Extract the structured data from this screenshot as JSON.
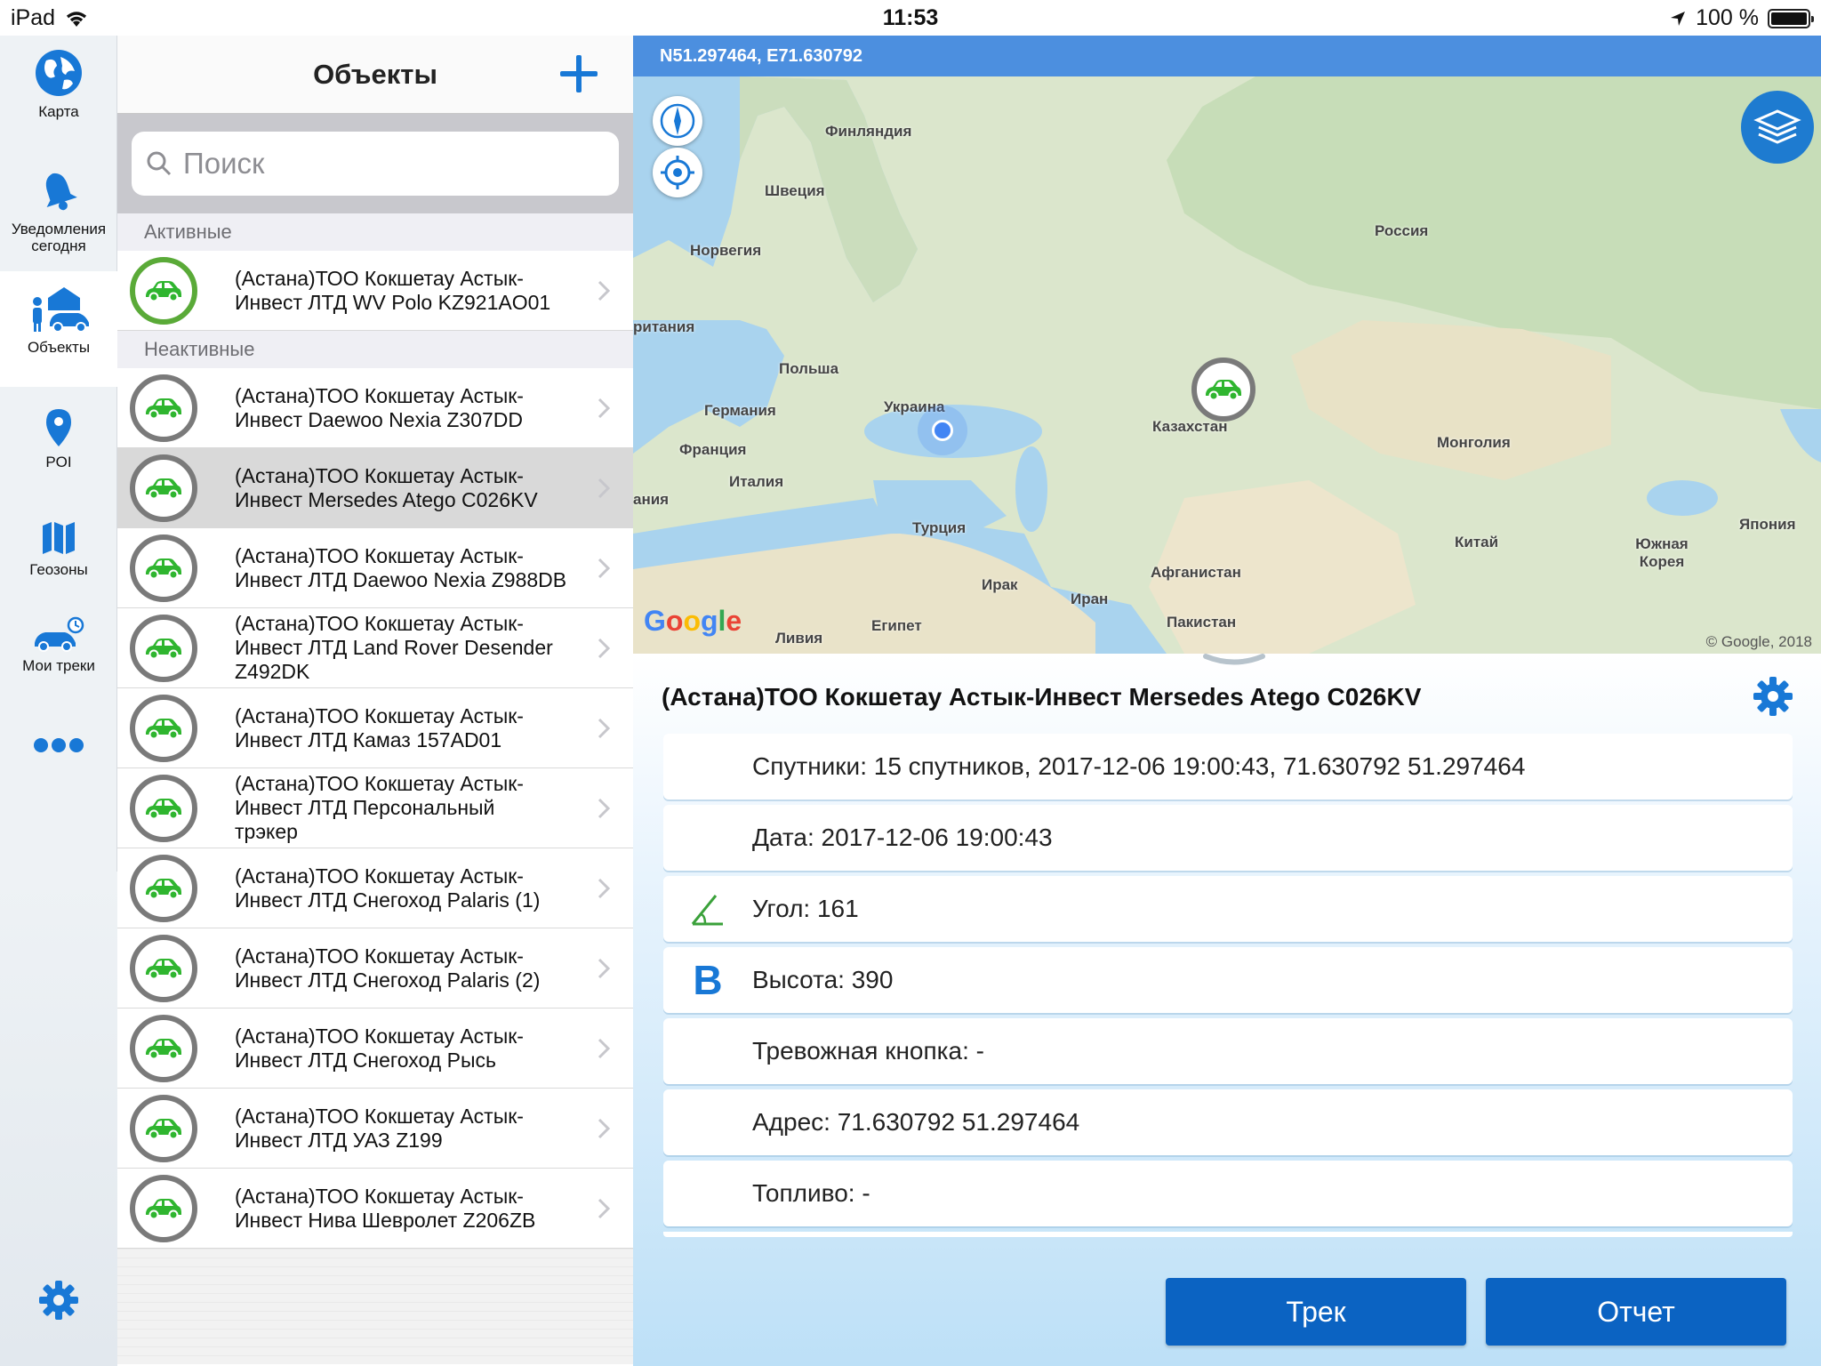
{
  "status": {
    "device": "iPad",
    "time": "11:53",
    "battery": "100 %"
  },
  "rail": {
    "items": [
      {
        "label": "Карта",
        "icon": "globe-icon"
      },
      {
        "label": "Уведомления сегодня",
        "icon": "bell-icon"
      },
      {
        "label": "Объекты",
        "icon": "objects-icon"
      },
      {
        "label": "POI",
        "icon": "pin-icon"
      },
      {
        "label": "Геозоны",
        "icon": "map-zones-icon"
      },
      {
        "label": "Мои треки",
        "icon": "car-clock-icon"
      }
    ],
    "active_index": 2,
    "more_icon": "ellipsis-icon",
    "settings_icon": "gear-icon"
  },
  "list": {
    "title": "Объекты",
    "search_placeholder": "Поиск",
    "sections": [
      {
        "label": "Активные",
        "items": [
          {
            "l1": "(Астана)ТОО Кокшетау Астык-",
            "l2": "Инвест ЛТД WV Polo KZ921AO01",
            "active": true
          }
        ]
      },
      {
        "label": "Неактивные",
        "items": [
          {
            "l1": "(Астана)ТОО Кокшетау Астык-",
            "l2": "Инвест Daewoo Nexia Z307DD"
          },
          {
            "l1": "(Астана)ТОО Кокшетау Астык-",
            "l2": "Инвест Mersedes Atego C026KV",
            "selected": true
          },
          {
            "l1": "(Астана)ТОО Кокшетау Астык-",
            "l2": "Инвест ЛТД Daewoo Nexia Z988DB"
          },
          {
            "l1": "(Астана)ТОО Кокшетау Астык-",
            "l2": "Инвест ЛТД Land Rover Desender",
            "l3": "Z492DK"
          },
          {
            "l1": "(Астана)ТОО Кокшетау Астык-",
            "l2": "Инвест ЛТД Камаз 157AD01"
          },
          {
            "l1": "(Астана)ТОО Кокшетау Астык-",
            "l2": "Инвест ЛТД Персональный",
            "l3": "трэкер"
          },
          {
            "l1": "(Астана)ТОО Кокшетау Астык-",
            "l2": "Инвест ЛТД Снегоход Palaris (1)"
          },
          {
            "l1": "(Астана)ТОО Кокшетау Астык-",
            "l2": "Инвест ЛТД Снегоход Palaris (2)"
          },
          {
            "l1": "(Астана)ТОО Кокшетау Астык-",
            "l2": "Инвест ЛТД Снегоход Рысь"
          },
          {
            "l1": "(Астана)ТОО Кокшетау Астык-",
            "l2": "Инвест ЛТД УАЗ Z199"
          },
          {
            "l1": "(Астана)ТОО Кокшетау Астык-",
            "l2": "Инвест Нива Шевролет Z206ZB"
          }
        ]
      }
    ]
  },
  "map": {
    "coords": "N51.297464, E71.630792",
    "labels": [
      "Финляндия",
      "Швеция",
      "Норвегия",
      "Россия",
      "ритания",
      "Польша",
      "Германия",
      "Украина",
      "Франция",
      "Италия",
      "ания",
      "Казахстан",
      "Монголия",
      "Турция",
      "Китай",
      "Япония",
      "Южная Корея",
      "Ирак",
      "Иран",
      "Афганистан",
      "Пакистан",
      "Египет",
      "Ливия"
    ],
    "google": "Google",
    "copyright": "© Google, 2018"
  },
  "details": {
    "title": "(Астана)ТОО Кокшетау Астык-Инвест Mersedes Atego C026KV",
    "rows": [
      {
        "text": "Спутники: 15 спутников, 2017-12-06 19:00:43, 71.630792 51.297464",
        "icon": ""
      },
      {
        "text": "Дата: 2017-12-06 19:00:43",
        "icon": ""
      },
      {
        "text": "Угол: 161",
        "icon": "angle-icon"
      },
      {
        "text": "Высота: 390",
        "icon": "height-b-icon",
        "glyph": "B"
      },
      {
        "text": "Тревожная кнопка: -",
        "icon": ""
      },
      {
        "text": "Адрес: 71.630792 51.297464",
        "icon": ""
      },
      {
        "text": "Топливо: -",
        "icon": ""
      }
    ],
    "buttons": {
      "track": "Трек",
      "report": "Отчет"
    }
  },
  "colors": {
    "accent": "#0b63c2",
    "active_ring": "#5aaa38",
    "inactive_ring": "#7a7a7a",
    "car": "#2fb52f"
  }
}
